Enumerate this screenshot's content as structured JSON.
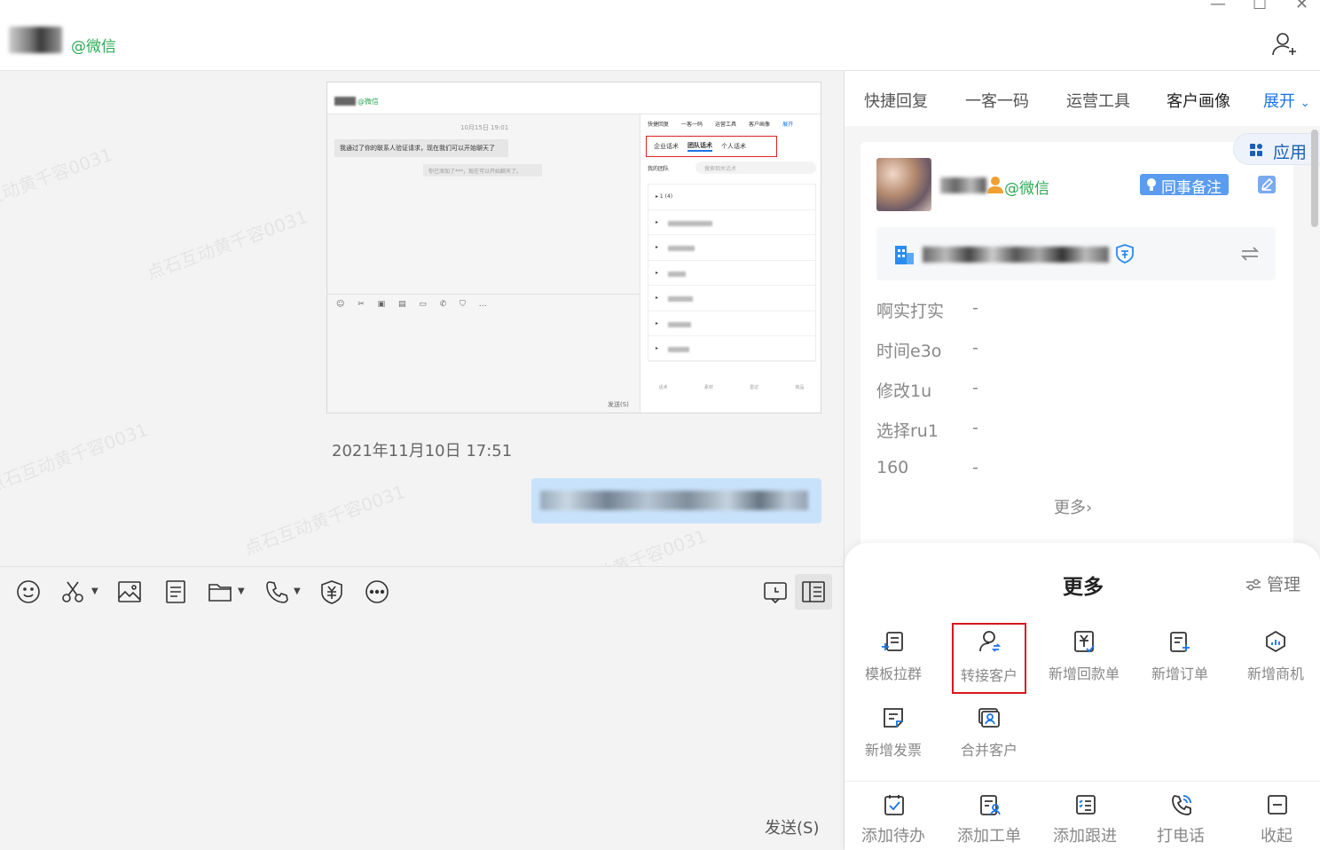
{
  "header": {
    "contact_tag": "@微信",
    "window_controls": [
      "—",
      "☐",
      "✕"
    ]
  },
  "chat": {
    "watermark": "点石互动黄千容0031",
    "screenshot": {
      "tag": "@微信",
      "date": "10月15日 19:01",
      "message": "我通过了你的联系人验证请求，现在我们可以开始聊天了",
      "note": "你已添加了***，现在可以开始聊天了。",
      "tabs": [
        "快捷回复",
        "一客一码",
        "运营工具",
        "客户画像",
        "展开"
      ],
      "sub_tabs": [
        "企业话术",
        "团队话术",
        "个人话术"
      ],
      "team_label": "我的团队",
      "search_placeholder": "搜索相关话术",
      "first_item": "1 (4)",
      "send": "发送(S)",
      "bottom_tabs": [
        "话术",
        "素材",
        "雷达",
        "商品"
      ]
    },
    "date": "2021年11月10日 17:51"
  },
  "input": {
    "send_label": "发送(S)"
  },
  "right_panel": {
    "tabs": [
      {
        "label": "快捷回复",
        "active": false
      },
      {
        "label": "一客一码",
        "active": false
      },
      {
        "label": "运营工具",
        "active": false
      },
      {
        "label": "客户画像",
        "active": true
      },
      {
        "label": "展开",
        "active": false
      }
    ],
    "app_button": "应用",
    "customer": {
      "tag": "@微信",
      "colleague_note": "同事备注",
      "fields": [
        {
          "label": "啊实打实",
          "value": "-"
        },
        {
          "label": "时间e3o",
          "value": "-"
        },
        {
          "label": "修改1u",
          "value": "-"
        },
        {
          "label": "选择ru1",
          "value": "-"
        },
        {
          "label": "160",
          "value": "-"
        }
      ],
      "more": "更多›"
    },
    "sheet": {
      "title": "更多",
      "manage": "管理",
      "items": [
        {
          "label": "模板拉群",
          "icon": "template-group-icon"
        },
        {
          "label": "转接客户",
          "icon": "transfer-customer-icon",
          "highlighted": true
        },
        {
          "label": "新增回款单",
          "icon": "payment-receipt-icon"
        },
        {
          "label": "新增订单",
          "icon": "order-icon"
        },
        {
          "label": "新增商机",
          "icon": "opportunity-icon"
        },
        {
          "label": "新增发票",
          "icon": "invoice-icon"
        },
        {
          "label": "合并客户",
          "icon": "merge-customer-icon"
        }
      ],
      "bottom": [
        {
          "label": "添加待办",
          "icon": "todo-icon"
        },
        {
          "label": "添加工单",
          "icon": "work-order-icon"
        },
        {
          "label": "添加跟进",
          "icon": "follow-up-icon"
        },
        {
          "label": "打电话",
          "icon": "phone-call-icon"
        },
        {
          "label": "收起",
          "icon": "collapse-icon"
        }
      ]
    }
  },
  "colors": {
    "wechat_green": "#2daa55",
    "accent_blue": "#1a73e8",
    "highlight_red": "#d9161e",
    "bubble_blue": "#c9e2fb"
  }
}
